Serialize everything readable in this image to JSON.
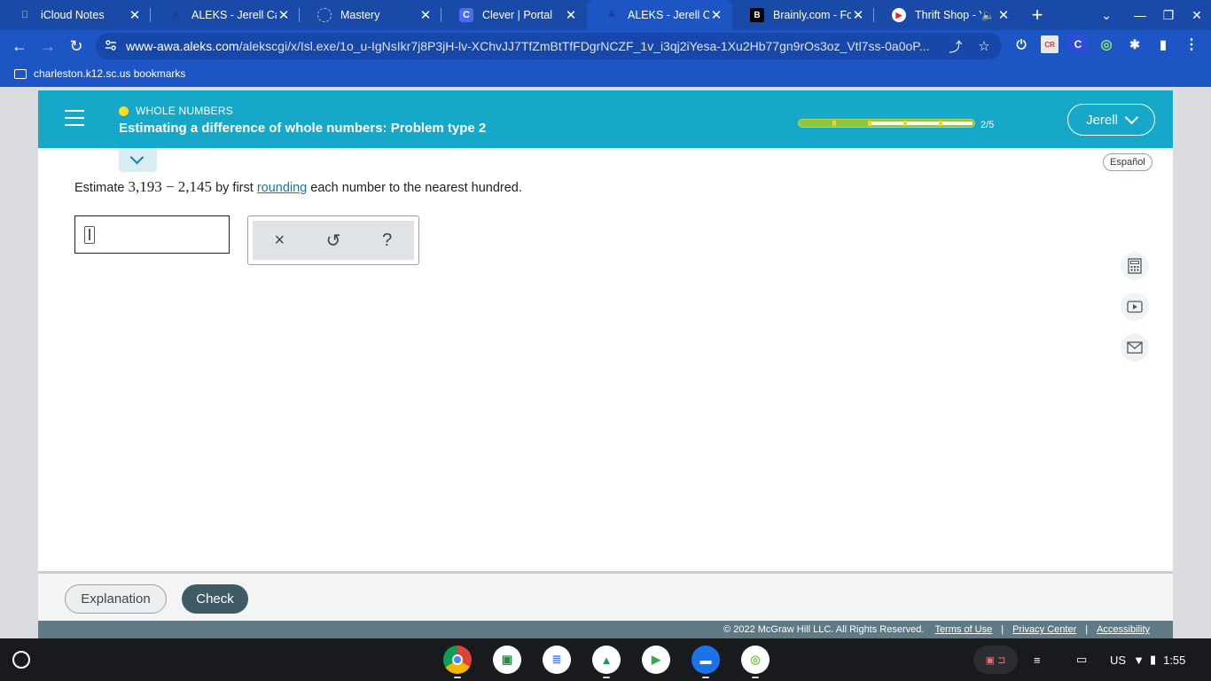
{
  "browser": {
    "tabs": [
      {
        "title": "iCloud Notes",
        "icon": "apple-icon",
        "active": false
      },
      {
        "title": "ALEKS - Jerell Cag",
        "icon": "aleks-icon",
        "active": false
      },
      {
        "title": "Mastery",
        "icon": "mastery-icon",
        "active": false
      },
      {
        "title": "Clever | Portal",
        "icon": "clever-icon",
        "active": false
      },
      {
        "title": "ALEKS - Jerell Cag",
        "icon": "aleks-icon",
        "active": true
      },
      {
        "title": "Brainly.com - For s",
        "icon": "brainly-icon",
        "active": false
      },
      {
        "title": "Thrift Shop - Y",
        "icon": "youtube-icon",
        "active": false
      }
    ],
    "url_host": "www-awa.aleks.com",
    "url_path": "/alekscgi/x/Isl.exe/1o_u-IgNsIkr7j8P3jH-lv-XChvJJ7TfZmBtTfFDgrNCZF_1v_i3qj2iYesa-1Xu2Hb77gn9rOs3oz_Vtl7ss-0a0oP...",
    "bookmark_folder": "charleston.k12.sc.us bookmarks"
  },
  "header": {
    "category": "WHOLE NUMBERS",
    "title": "Estimating a difference of whole numbers: Problem type 2",
    "progress_label": "2/5",
    "progress_fraction": 0.4,
    "user_name": "Jerell"
  },
  "language_toggle": "Español",
  "question": {
    "prefix": "Estimate",
    "expression": "3,193 − 2,145",
    "middle": "by first",
    "link": "rounding",
    "suffix": "each number to the nearest hundred.",
    "answer_value": ""
  },
  "keypad": {
    "clear_symbol": "×",
    "undo_symbol": "↺",
    "help_symbol": "?"
  },
  "footer": {
    "explanation_label": "Explanation",
    "check_label": "Check",
    "copyright": "© 2022 McGraw Hill LLC. All Rights Reserved.",
    "terms": "Terms of Use",
    "privacy": "Privacy Center",
    "accessibility": "Accessibility",
    "separator": "|"
  },
  "system": {
    "locale": "US",
    "time": "1:55"
  },
  "colors": {
    "browser_frame": "#1a4aa8",
    "aleks_header": "#16a8c9",
    "check_button": "#3f5b66",
    "link": "#1a74a8"
  }
}
